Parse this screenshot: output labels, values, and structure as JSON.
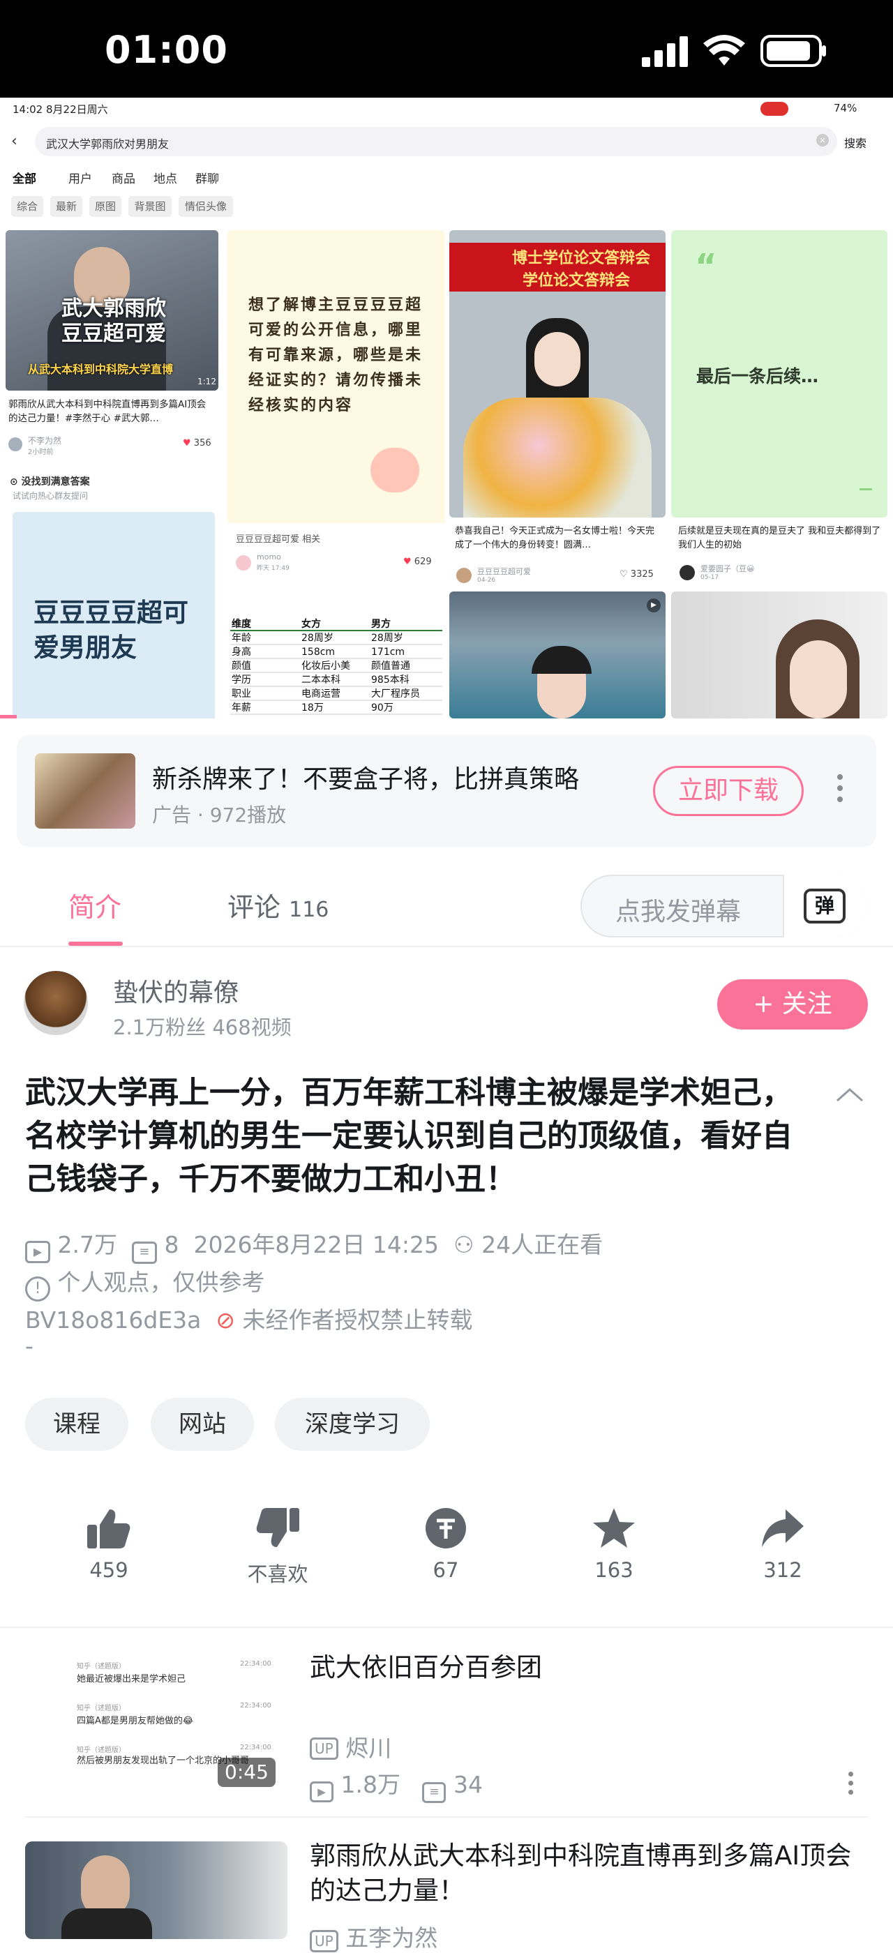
{
  "status_bar": {
    "time": "01:00"
  },
  "video": {
    "ipad_time": "14:02  8月22日周六",
    "ipad_battery": "74%",
    "search_query": "武汉大学郭雨欣对男朋友",
    "search_btn": "搜索",
    "tabs": [
      "全部",
      "用户",
      "商品",
      "地点",
      "群聊"
    ],
    "filters": [
      "综合",
      "最新",
      "原图",
      "背景图",
      "情侣头像"
    ],
    "cards": {
      "c1_overlay1": "武大郭雨欣",
      "c1_overlay2": "豆豆超可爱",
      "c1_banner": "从武大本科到中科院大学直博",
      "c1_duration": "1:12",
      "c1_title": "郭雨欣从武大本科到中科院直博再到多篇AI顶会的达己力量！#李然于心 #武大郭…",
      "c1_user": "不李为然",
      "c1_time": "2小时前",
      "c1_likes": "356",
      "c1b_question": "没找到满意答案",
      "c1b_sub": "试试向热心群友提问",
      "c1b_big": "豆豆豆豆超可爱男朋友",
      "c2_text": "想了解博主豆豆豆豆超可爱的公开信息，哪里有可靠来源，哪些是未经证实的？请勿传播未经核实的内容",
      "c2_footer": "豆豆豆豆超可爱 相关",
      "c2_user": "momo",
      "c2_time": "昨天 17:49",
      "c2_likes": "629",
      "table_header": [
        "维度",
        "女方",
        "男方"
      ],
      "table_rows": [
        [
          "年龄",
          "28周岁",
          "28周岁"
        ],
        [
          "身高",
          "158cm",
          "171cm"
        ],
        [
          "颜值",
          "化妆后小美",
          "颜值普通"
        ],
        [
          "学历",
          "二本本科",
          "985本科"
        ],
        [
          "职业",
          "电商运营",
          "大厂程序员"
        ],
        [
          "年薪",
          "18万",
          "90万"
        ]
      ],
      "c3_banner1": "博士学位论文答辩会",
      "c3_banner2": "学位论文答辩会",
      "c3_caption": "恭喜我自己！今天正式成为一名女博士啦！今天完成了一个伟大的身份转变！圆满…",
      "c3_user": "豆豆豆豆超可爱",
      "c3_time": "04-26",
      "c3_likes": "3325",
      "c4_text": "最后一条后续…",
      "c4_caption": "后续就是豆夫现在真的是豆夫了 我和豆夫都得到了我们人生的初始",
      "c4_user": "爱要圆子（豆😀",
      "c4_time": "05-17"
    }
  },
  "ad": {
    "title": "新杀牌来了！不要盒子将，比拼真策略",
    "sub": "广告 · 972播放",
    "btn": "立即下载"
  },
  "tabs": {
    "intro": "简介",
    "comments": "评论",
    "comments_count": "116",
    "danmaku_placeholder": "点我发弹幕",
    "danmaku_icon": "弹"
  },
  "uploader": {
    "name": "蛰伏的幕僚",
    "stats": "2.1万粉丝   468视频",
    "follow": "+ 关注"
  },
  "video_info": {
    "title": "武汉大学再上一分，百万年薪工科博主被爆是学术妲己，名校学计算机的男生一定要认识到自己的顶级值，看好自己钱袋子，千万不要做力工和小丑！",
    "views": "2.7万",
    "danmaku": "8",
    "date": "2026年8月22日 14:25",
    "watching": "24人正在看",
    "notice": "个人观点，仅供参考",
    "bvid": "BV18o816dE3a",
    "no_repost": "未经作者授权禁止转载",
    "dash": "-"
  },
  "tags": [
    "课程",
    "网站",
    "深度学习"
  ],
  "actions": {
    "like": "459",
    "dislike": "不喜欢",
    "coin": "67",
    "fav": "163",
    "share": "312"
  },
  "recommend": [
    {
      "title": "武大依旧百分百参团",
      "author": "烬川",
      "views": "1.8万",
      "danmaku": "34",
      "duration": "0:45",
      "thumb_lines": [
        {
          "name": "知乎（述题版）",
          "time": "22:34:00",
          "text": "她最近被爆出来是学术妲己"
        },
        {
          "name": "知乎（述题版）",
          "time": "22:34:00",
          "text": "四篇A都是男朋友帮她做的😂"
        },
        {
          "name": "知乎（述题版）",
          "time": "22:34:00",
          "text": "然后被男朋友发现出轨了一个北京的小哥哥"
        }
      ]
    },
    {
      "title": "郭雨欣从武大本科到中科院直博再到多篇AI顶会的达己力量！",
      "author": "五李为然"
    }
  ]
}
